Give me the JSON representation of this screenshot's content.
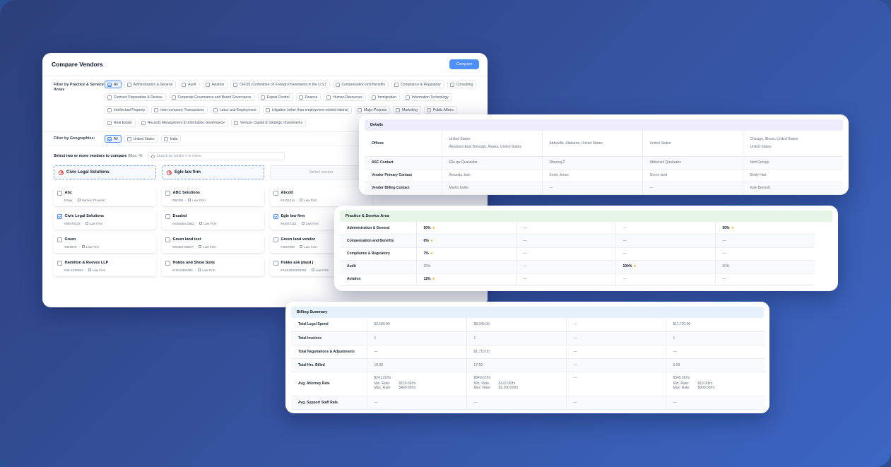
{
  "compare": {
    "title": "Compare Vendors",
    "compare_button": "Compare",
    "practice_filter_label": "Filter by Practice & Service Areas",
    "practice_areas": [
      {
        "label": "All",
        "checked": true
      },
      {
        "label": "Administration & General"
      },
      {
        "label": "Audit"
      },
      {
        "label": "Aviation"
      },
      {
        "label": "CFIUS (Committee on Foreign Investments in the U.S.)"
      },
      {
        "label": "Compensation and Benefits"
      },
      {
        "label": "Compliance & Regulatory"
      },
      {
        "label": "Consulting"
      },
      {
        "label": "Contract Preparation & Review"
      },
      {
        "label": "Corporate Governance and Board Governance"
      },
      {
        "label": "Export Control"
      },
      {
        "label": "Finance"
      },
      {
        "label": "Human Resources"
      },
      {
        "label": "Immigration"
      },
      {
        "label": "Information Technology"
      },
      {
        "label": "Intellectual Property"
      },
      {
        "label": "Inter-company Transactions"
      },
      {
        "label": "Labor and Employment"
      },
      {
        "label": "Litigation (other than employment-related claims)"
      },
      {
        "label": "Major Projects"
      },
      {
        "label": "Marketing"
      },
      {
        "label": "Public Affairs"
      },
      {
        "label": "Real Estate"
      },
      {
        "label": "Records Management & Information Governance"
      },
      {
        "label": "Venture Capital & Strategic Investments"
      }
    ],
    "geo_filter_label": "Filter by Geographies:",
    "geographies": [
      {
        "label": "All",
        "checked": true
      },
      {
        "label": "United States"
      },
      {
        "label": "India"
      }
    ],
    "select_label": "Select two or more vendors to compare",
    "select_hint": "(Max. 4):",
    "search_placeholder": "Search by vendor # or name",
    "selected_slots": [
      "Civic Legal Solutions",
      "Egle law firm"
    ],
    "empty_slot": "Select vendor",
    "vendors": [
      {
        "name": "Abc",
        "id": "Raiax",
        "type": "Service Provider",
        "checked": false
      },
      {
        "name": "ABC Solutions",
        "id": "#56789",
        "type": "Law Firm",
        "checked": false
      },
      {
        "name": "Abcdd",
        "id": "#2431214",
        "type": "Law Firm",
        "checked": false
      },
      {
        "name": "Civic Legal Solutions",
        "id": "#99478223",
        "type": "Law Firm",
        "checked": true
      },
      {
        "name": "Dsadsd",
        "id": "Asdsadsa dasd",
        "type": "Law Firm",
        "checked": false
      },
      {
        "name": "Egle law firm",
        "id": "#81672181",
        "type": "Law Firm",
        "checked": true
      },
      {
        "name": "Green",
        "id": "#345678",
        "type": "Law Firm",
        "checked": false
      },
      {
        "name": "Green land test",
        "id": "#00458783697",
        "type": "Law Firm",
        "checked": false
      },
      {
        "name": "Green land vendor",
        "id": "#4567890",
        "type": "Law Firm",
        "checked": false
      },
      {
        "name": "Hamilton & Reeves LLP",
        "id": "#45-1234561",
        "type": "Law Firm",
        "checked": false
      },
      {
        "name": "Hobbs and Show Suits",
        "id": "#HSL9384394",
        "type": "Law Firm",
        "checked": false
      },
      {
        "name": "Hskks ask jdasd j",
        "id": "#ASK2834938384",
        "type": "Law Firm",
        "checked": false
      }
    ]
  },
  "details": {
    "title": "Details",
    "rows": [
      {
        "label": "Offices",
        "cells": [
          [
            "United States",
            "Aleutians East Borough, Alaska, United States"
          ],
          [
            "Abbeville, Alabama, United States"
          ],
          [
            "United States"
          ],
          [
            "Chicago, Illinois, United States",
            "United States"
          ]
        ]
      },
      {
        "label": "ASC Contact",
        "cells": [
          [
            "Ella qw Qualwabs"
          ],
          [
            "Dheeraj P"
          ],
          [
            "Abhishek Qualwabs"
          ],
          [
            "Ned George"
          ]
        ]
      },
      {
        "label": "Vendor Primary Contact",
        "cells": [
          [
            "Amanda Jack"
          ],
          [
            "Kevin Jones"
          ],
          [
            "Green land"
          ],
          [
            "Emily Hart"
          ]
        ]
      },
      {
        "label": "Vendor Billing Contact",
        "cells": [
          [
            "Martin Keller"
          ],
          [
            "—"
          ],
          [
            "—"
          ],
          [
            "Kyle Bennett"
          ]
        ]
      }
    ]
  },
  "practice": {
    "title": "Practice & Service Area",
    "rows": [
      {
        "label": "Administration & General",
        "cells": [
          {
            "v": "50%",
            "star": true
          },
          {
            "v": "—"
          },
          {
            "v": "—"
          },
          {
            "v": "50%",
            "star": true
          }
        ]
      },
      {
        "label": "Compensation and Benefits",
        "cells": [
          {
            "v": "6%",
            "star": true
          },
          {
            "v": "—"
          },
          {
            "v": "—"
          },
          {
            "v": "—"
          }
        ]
      },
      {
        "label": "Compliance & Regulatory",
        "cells": [
          {
            "v": "7%",
            "star": true
          },
          {
            "v": "—"
          },
          {
            "v": "—"
          },
          {
            "v": "—"
          }
        ]
      },
      {
        "label": "Audit",
        "cells": [
          {
            "v": "25%"
          },
          {
            "v": "—"
          },
          {
            "v": "100%",
            "star": true
          },
          {
            "v": "50%"
          }
        ]
      },
      {
        "label": "Aviation",
        "cells": [
          {
            "v": "12%",
            "star": true
          },
          {
            "v": "—"
          },
          {
            "v": "—"
          },
          {
            "v": "—"
          }
        ]
      }
    ]
  },
  "billing": {
    "title": "Billing Summary",
    "min_label": "Min. Rate:",
    "max_label": "Max. Rate:",
    "rows": [
      {
        "label": "Total Legal Spend",
        "cells": [
          "$2,500.00",
          "$8,345.00",
          "—",
          "$11,720.00"
        ]
      },
      {
        "label": "Total Invoices",
        "cells": [
          "1",
          "1",
          "—",
          "1"
        ]
      },
      {
        "label": "Total Negotiations & Adjustments",
        "cells": [
          "—",
          "$1,710.00",
          "—",
          "—"
        ]
      },
      {
        "label": "Total Hrs. Billed",
        "cells": [
          "10.00",
          "17.50",
          "—",
          "5.00"
        ]
      },
      {
        "label": "Avg. Attorney Rate",
        "rates": [
          {
            "avg": "$241.29/hr",
            "min": "$120.00/hr",
            "max": "$400.00/hr"
          },
          {
            "avg": "$840.67/hr",
            "min": "$122.00/hr",
            "max": "$1,200.00/hr"
          },
          null,
          {
            "avg": "$345.56/hr",
            "min": "$10.00/hr",
            "max": "$900.00/hr"
          }
        ]
      },
      {
        "label": "Avg. Support Staff Rate",
        "cells": [
          "—",
          "—",
          "—",
          "—"
        ]
      }
    ]
  },
  "colors": {
    "accent": "#4f8ff7",
    "details_header": "#efedfb",
    "practice_header": "#e6f5e6",
    "billing_header": "#e6f1fb",
    "star": "#f5b301"
  }
}
